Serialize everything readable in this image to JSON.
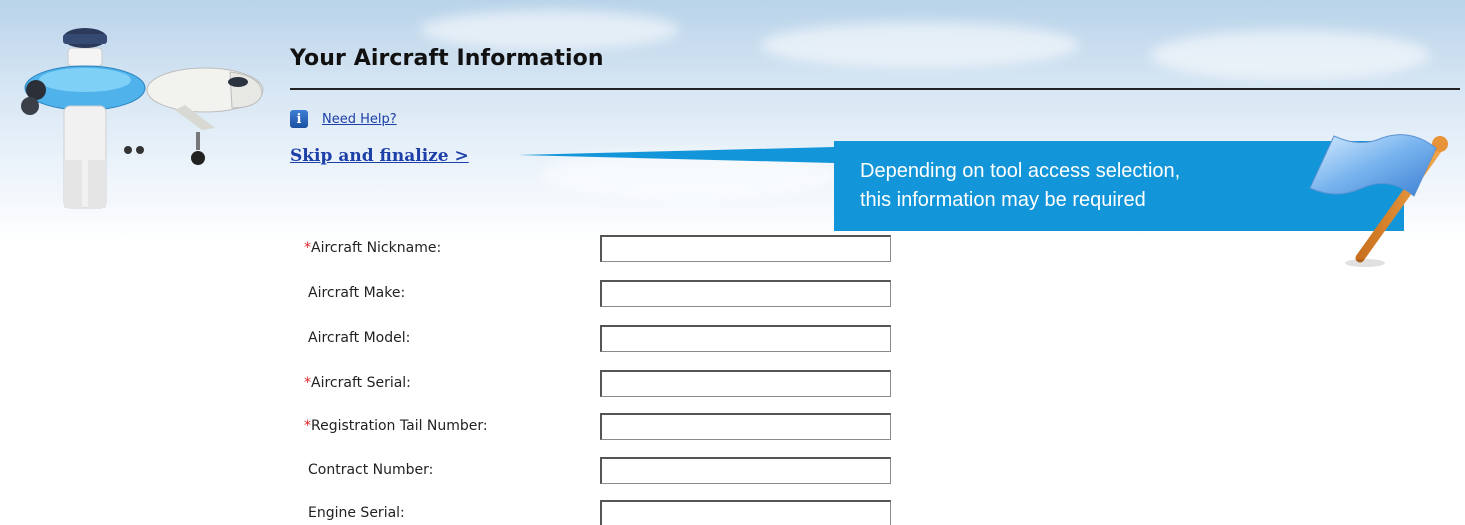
{
  "header": {
    "title": "Your Aircraft Information",
    "help_label": "Need Help?",
    "skip_label": "Skip and finalize >"
  },
  "callout": {
    "line1": "Depending on tool access selection,",
    "line2": "this information may be required"
  },
  "form": {
    "required_mark": "*",
    "fields": [
      {
        "label": "Aircraft Nickname:",
        "required": true,
        "value": "",
        "placeholder": ""
      },
      {
        "label": "Aircraft Make:",
        "required": false,
        "value": "",
        "placeholder": ""
      },
      {
        "label": "Aircraft Model:",
        "required": false,
        "value": "",
        "placeholder": ""
      },
      {
        "label": "Aircraft Serial:",
        "required": true,
        "value": "",
        "placeholder": ""
      },
      {
        "label": "Registration Tail Number:",
        "required": true,
        "value": "",
        "placeholder": ""
      },
      {
        "label": "Contract Number:",
        "required": false,
        "value": "",
        "placeholder": ""
      },
      {
        "label": "Engine Serial:",
        "required": false,
        "value": "",
        "placeholder": ""
      }
    ]
  },
  "icons": {
    "info": "info-icon",
    "mascot": "airplane-pilot-mascot",
    "flag": "flag-icon"
  },
  "colors": {
    "link": "#1c3fa8",
    "callout_bg": "#1396d9",
    "required": "#e0242c",
    "title_rule": "#222222"
  }
}
